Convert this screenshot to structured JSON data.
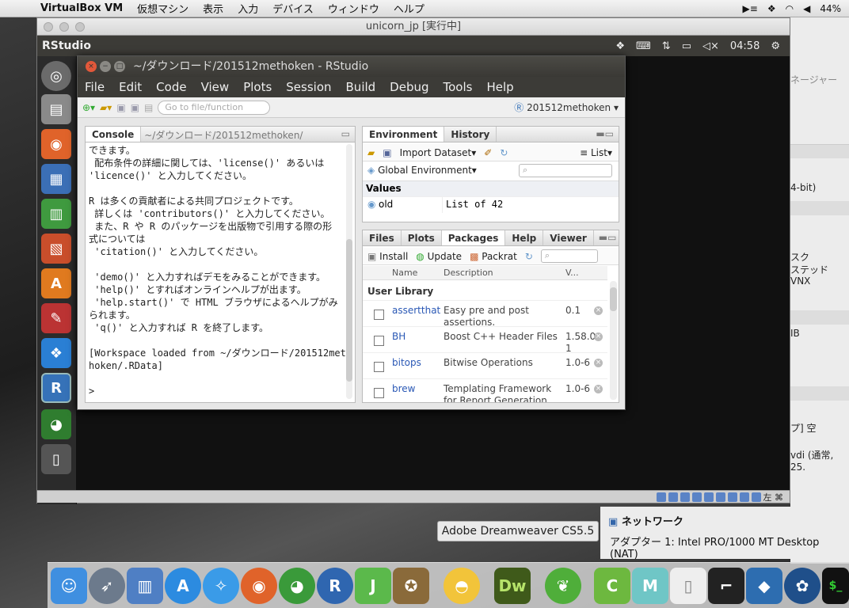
{
  "menubar": {
    "app": "VirtualBox VM",
    "items": [
      "仮想マシン",
      "表示",
      "入力",
      "デバイス",
      "ウィンドウ",
      "ヘルプ"
    ],
    "battery": "44%"
  },
  "vbox": {
    "title": "unicorn_jp [実行中]",
    "status_right": "左 ⌘"
  },
  "ubuntu": {
    "app_title": "RStudio",
    "clock": "04:58"
  },
  "rstudio": {
    "title": "~/ダウンロード/201512methoken - RStudio",
    "menu": [
      "File",
      "Edit",
      "Code",
      "View",
      "Plots",
      "Session",
      "Build",
      "Debug",
      "Tools",
      "Help"
    ],
    "goto_placeholder": "Go to file/function",
    "project": "201512methoken",
    "console": {
      "tab": "Console",
      "path": "~/ダウンロード/201512methoken/",
      "text": "できます。\n 配布条件の詳細に関しては、'license()' あるいは\n'licence()' と入力してください。\n\nR は多くの貢献者による共同プロジェクトです。\n 詳しくは 'contributors()' と入力してください。\n また、R や R のパッケージを出版物で引用する際の形\n式については\n 'citation()' と入力してください。\n\n 'demo()' と入力すればデモをみることができます。\n 'help()' とすればオンラインヘルプが出ます。\n 'help.start()' で HTML ブラウザによるヘルプがみ\nられます。\n 'q()' と入力すれば R を終了します。\n\n[Workspace loaded from ~/ダウンロード/201512met\nhoken/.RData]\n\n>"
    },
    "env": {
      "tabs": [
        "Environment",
        "History"
      ],
      "import": "Import Dataset",
      "list": "List",
      "scope": "Global Environment",
      "section": "Values",
      "var_name": "old",
      "var_value": "List of 42"
    },
    "pkgs": {
      "tabs": [
        "Files",
        "Plots",
        "Packages",
        "Help",
        "Viewer"
      ],
      "install": "Install",
      "update": "Update",
      "packrat": "Packrat",
      "cols": [
        "Name",
        "Description",
        "V..."
      ],
      "section": "User Library",
      "rows": [
        {
          "name": "assertthat",
          "desc": "Easy pre and post assertions.",
          "ver": "0.1"
        },
        {
          "name": "BH",
          "desc": "Boost C++ Header Files",
          "ver": "1.58.0-1"
        },
        {
          "name": "bitops",
          "desc": "Bitwise Operations",
          "ver": "1.0-6"
        },
        {
          "name": "brew",
          "desc": "Templating Framework for Report Generation",
          "ver": "1.0-6"
        }
      ]
    }
  },
  "rightpanel": {
    "t1": "ネージャー",
    "t2": "4-bit)",
    "t3": "スク",
    "t4": "ステッド",
    "t5": "VNX",
    "t6": "IB",
    "t7": "プ] 空",
    "t8": "vdi (通常, 25."
  },
  "tooltip": "Adobe Dreamweaver CS5.5",
  "network": {
    "title": "ネットワーク",
    "adapter": "アダプター 1:   Intel PRO/1000 MT Desktop (NAT)"
  },
  "dock_icons": [
    "finder-icon",
    "launchpad-icon",
    "keynote-icon",
    "appstore-icon",
    "safari-icon",
    "firefox-icon",
    "chrome-icon",
    "r-icon",
    "jedit-icon",
    "owl-icon",
    "cyberduck-icon",
    "dreamweaver-icon",
    "evernote-icon",
    "coteditor-icon",
    "mendeley-icon",
    "preview-icon",
    "terminal-icon",
    "virtualbox-icon",
    "sourcetree-icon",
    "terminal2-icon"
  ],
  "colors": {
    "ubuntu_dark": "#3c3b37",
    "link": "#2a58b5"
  }
}
